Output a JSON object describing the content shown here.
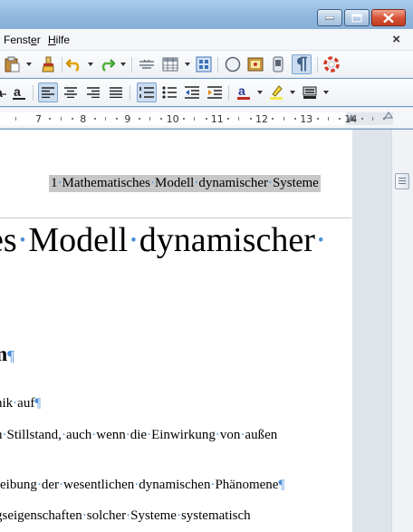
{
  "menubar": {
    "items": [
      {
        "label": "Fenster",
        "accel_index": 5
      },
      {
        "label": "Hilfe",
        "accel_index": 0
      }
    ],
    "close_glyph": "×"
  },
  "ruler": {
    "numbers": [
      "7",
      "8",
      "9",
      "10",
      "11",
      "12",
      "13",
      "14"
    ]
  },
  "document": {
    "running_header": "1 Mathematisches Modell dynamischer Systeme",
    "chapter_title": "es Modell dynamischer",
    "section_title": "m",
    "lines": [
      "nik auf",
      "n Stillstand, auch wenn die Einwirkung von außen",
      "reibung der wesentlichen dynamischen Phänomene",
      "gseigenschaften solcher Systeme systematisch"
    ]
  },
  "colors": {
    "titlebar": "#8fb6dd",
    "close_button": "#c23b20",
    "formatting_marks": "#4a8ed8",
    "header_highlight": "#c7c7c7"
  }
}
